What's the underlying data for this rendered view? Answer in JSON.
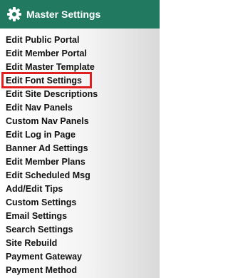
{
  "header": {
    "title": "Master Settings",
    "icon": "gear-icon",
    "background_color": "#217a60"
  },
  "menu": {
    "items": [
      {
        "label": "Edit Public Portal"
      },
      {
        "label": "Edit Member Portal"
      },
      {
        "label": "Edit Master Template"
      },
      {
        "label": "Edit Font Settings",
        "highlighted": true
      },
      {
        "label": "Edit Site Descriptions"
      },
      {
        "label": "Edit Nav Panels"
      },
      {
        "label": "Custom Nav Panels"
      },
      {
        "label": "Edit Log in Page"
      },
      {
        "label": "Banner Ad Settings"
      },
      {
        "label": "Edit Member Plans"
      },
      {
        "label": "Edit Scheduled Msg"
      },
      {
        "label": "Add/Edit Tips"
      },
      {
        "label": "Custom Settings"
      },
      {
        "label": "Email Settings"
      },
      {
        "label": "Search Settings"
      },
      {
        "label": "Site Rebuild"
      },
      {
        "label": "Payment Gateway"
      },
      {
        "label": "Payment Method"
      }
    ],
    "highlight_color": "#e02020"
  }
}
